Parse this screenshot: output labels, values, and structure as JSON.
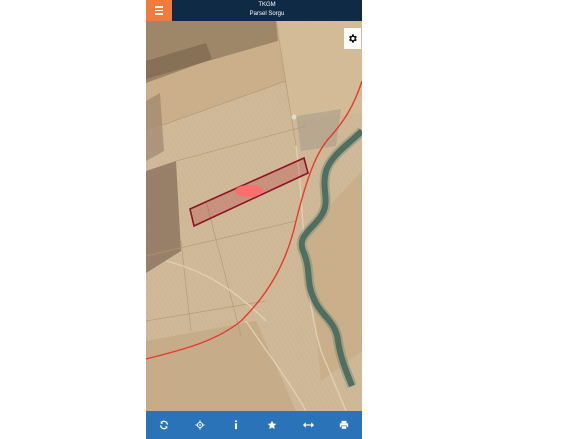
{
  "header": {
    "title": "TKGM",
    "subtitle": "Parsel Sorgu",
    "menu_icon": "hamburger-menu-icon"
  },
  "map": {
    "settings_icon": "gear-icon",
    "parcel_color": "#b01e2e",
    "boundary_line_color": "#e8392e",
    "marker_color": "#ff6b6b"
  },
  "toolbar": {
    "background_color": "#2b73b8",
    "buttons": [
      {
        "icon": "refresh-icon"
      },
      {
        "icon": "locate-icon"
      },
      {
        "icon": "info-icon"
      },
      {
        "icon": "star-icon"
      },
      {
        "icon": "measure-icon"
      },
      {
        "icon": "print-icon"
      }
    ]
  },
  "colors": {
    "header_bg": "#0f2a45",
    "menu_button_bg": "#f07b3f"
  }
}
